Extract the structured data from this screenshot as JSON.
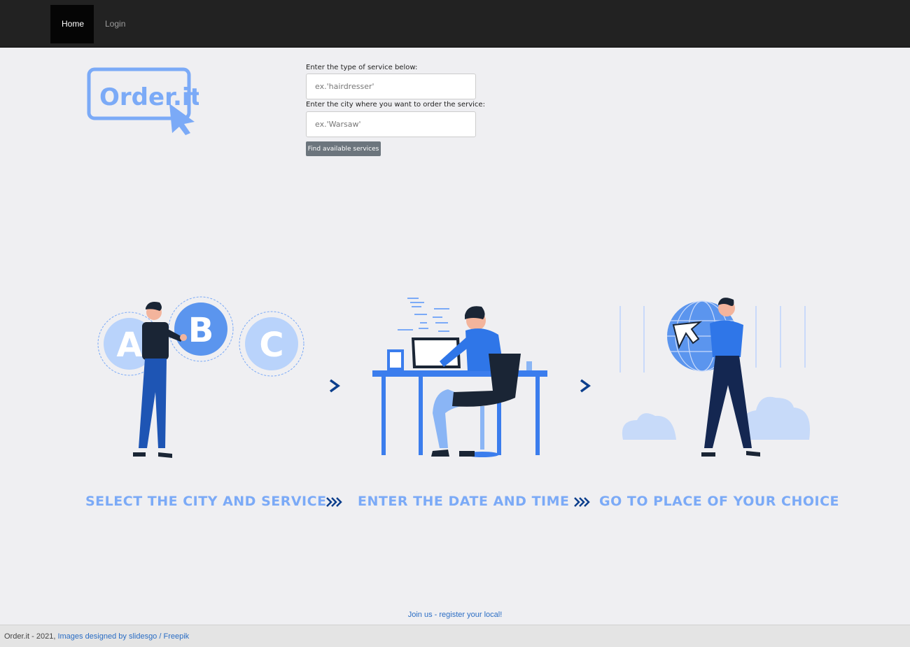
{
  "nav": {
    "home_label": "Home",
    "login_label": "Login"
  },
  "logo": {
    "text": "Order.it",
    "color": "#7baaf7"
  },
  "form": {
    "service_label": "Enter the type of service below:",
    "service_placeholder": "ex.'hairdresser'",
    "city_label": "Enter the city where you want to order the service:",
    "city_placeholder": "ex.'Warsaw'",
    "submit_label": "Find available services"
  },
  "illustration": {
    "letters": [
      "A",
      "B",
      "C"
    ],
    "steps": [
      "SELECT THE CITY AND SERVICE",
      "ENTER THE DATE AND TIME",
      "GO TO PLACE OF YOUR CHOICE"
    ]
  },
  "footer": {
    "join_link": "Join us - register your local!",
    "copyright": "Order.it - 2021,",
    "credits_link": "Images designed by slidesgo / Freepik"
  },
  "colors": {
    "navbar": "#222222",
    "accent_blue": "#7baaf7",
    "dark_blue": "#0b3e8c",
    "link": "#2a6dc4"
  }
}
